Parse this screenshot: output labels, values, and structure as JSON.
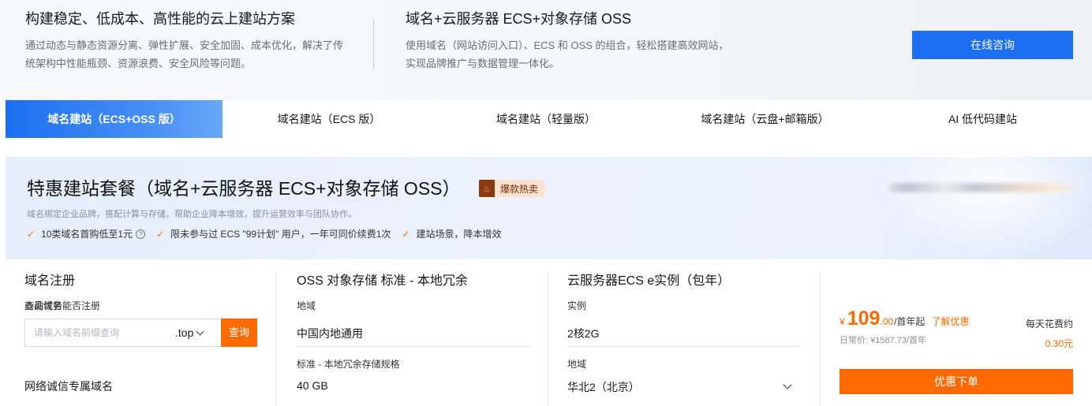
{
  "intro": {
    "left": {
      "title": "构建稳定、低成本、高性能的云上建站方案",
      "desc": "通过动态与静态资源分离、弹性扩展、安全加固、成本优化，解决了传统架构中性能瓶颈、资源浪费、安全风险等问题。"
    },
    "right": {
      "title": "域名+云服务器 ECS+对象存储 OSS",
      "desc": "使用域名（网站访问入口）、ECS 和 OSS 的组合，轻松搭建高效网站，实现品牌推广与数据管理一体化。"
    },
    "consult_label": "在线咨询"
  },
  "tabs": [
    {
      "label": "域名建站（ECS+OSS 版）",
      "active": true
    },
    {
      "label": "域名建站（ECS 版）",
      "active": false
    },
    {
      "label": "域名建站（轻量版）",
      "active": false
    },
    {
      "label": "域名建站（云盘+邮箱版）",
      "active": false
    },
    {
      "label": "AI 低代码建站",
      "active": false
    }
  ],
  "package": {
    "title": "特惠建站套餐（域名+云服务器 ECS+对象存储 OSS）",
    "hot_badge": "爆款热卖",
    "subtitle": "域名绑定企业品牌，搭配计算与存储，帮助企业降本增效，提升运营效率与团队协作。",
    "features": [
      "10类域名首购低至1元",
      "限未参与过 ECS \"99计划\" 用户，一年可同价续费1次",
      "建站场景，降本增效"
    ]
  },
  "domain": {
    "title": "域名注册",
    "query_label": "查询域名能否注册",
    "placeholder": "请输入域名前缀查询",
    "suffix": ".top",
    "query_button": "查询",
    "advantage_label": "商品优势",
    "advantage_value": "网络诚信专属域名"
  },
  "oss": {
    "title": "OSS 对象存储 标准 - 本地冗余",
    "region_label": "地域",
    "region_value": "中国内地通用",
    "spec_label": "标准 - 本地冗余存储规格",
    "spec_value": "40 GB"
  },
  "ecs": {
    "title": "云服务器ECS e实例（包年）",
    "instance_label": "实例",
    "instance_value": "2核2G",
    "region_label": "地域",
    "region_value": "华北2（北京）"
  },
  "price": {
    "currency": "¥",
    "integer": "109",
    "decimal": ".00",
    "unit": "/首年起",
    "discount_link": "了解优惠",
    "original": "日常价: ¥1587.73/首年",
    "daily_label": "每天花费约",
    "daily_value": "0.30元",
    "order_button": "优惠下单"
  },
  "colors": {
    "brand_blue": "#1b6ff0",
    "accent_orange": "#ff6a00"
  }
}
